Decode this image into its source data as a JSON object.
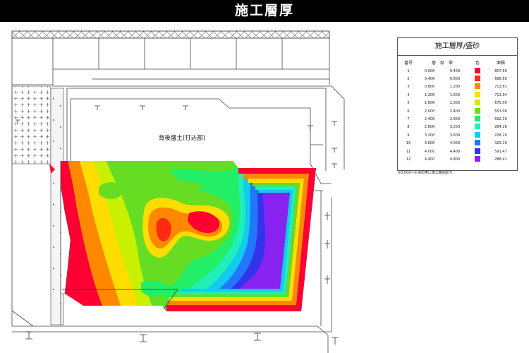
{
  "title": "施工層厚",
  "drawing": {
    "label": "背後盛土(打込部)"
  },
  "legend": {
    "title": "施工層厚/盛砂",
    "headers": {
      "no": "番号",
      "band": "層　厚　帯",
      "color": "色",
      "area": "面積"
    },
    "rows": [
      {
        "no": "1",
        "from": "0.000",
        "to": "0.400",
        "color": "#ff0033",
        "area": "807.60"
      },
      {
        "no": "2",
        "from": "0.400",
        "to": "0.800",
        "color": "#ff2a14",
        "area": "688.60"
      },
      {
        "no": "3",
        "from": "0.800",
        "to": "1.200",
        "color": "#ff8800",
        "area": "713.81"
      },
      {
        "no": "4",
        "from": "1.200",
        "to": "1.600",
        "color": "#ffdd00",
        "area": "713.94"
      },
      {
        "no": "5",
        "from": "1.600",
        "to": "2.000",
        "color": "#c8f000",
        "area": "675.00"
      },
      {
        "no": "6",
        "from": "2.000",
        "to": "2.400",
        "color": "#66dd22",
        "area": "553.00"
      },
      {
        "no": "7",
        "from": "2.400",
        "to": "2.800",
        "color": "#22ee66",
        "area": "692.10"
      },
      {
        "no": "8",
        "from": "2.800",
        "to": "3.200",
        "color": "#22eebb",
        "area": "284.26"
      },
      {
        "no": "9",
        "from": "3.200",
        "to": "3.600",
        "color": "#11ccee",
        "area": "228.20"
      },
      {
        "no": "10",
        "from": "3.600",
        "to": "4.000",
        "color": "#2277ff",
        "area": "329.10"
      },
      {
        "no": "11",
        "from": "4.000",
        "to": "4.400",
        "color": "#3333ee",
        "area": "591.47"
      },
      {
        "no": "12",
        "from": "4.400",
        "to": "4.800",
        "color": "#8822ee",
        "area": "288.41"
      }
    ],
    "note": "※0.000～0.400帯に施工範囲あり"
  }
}
